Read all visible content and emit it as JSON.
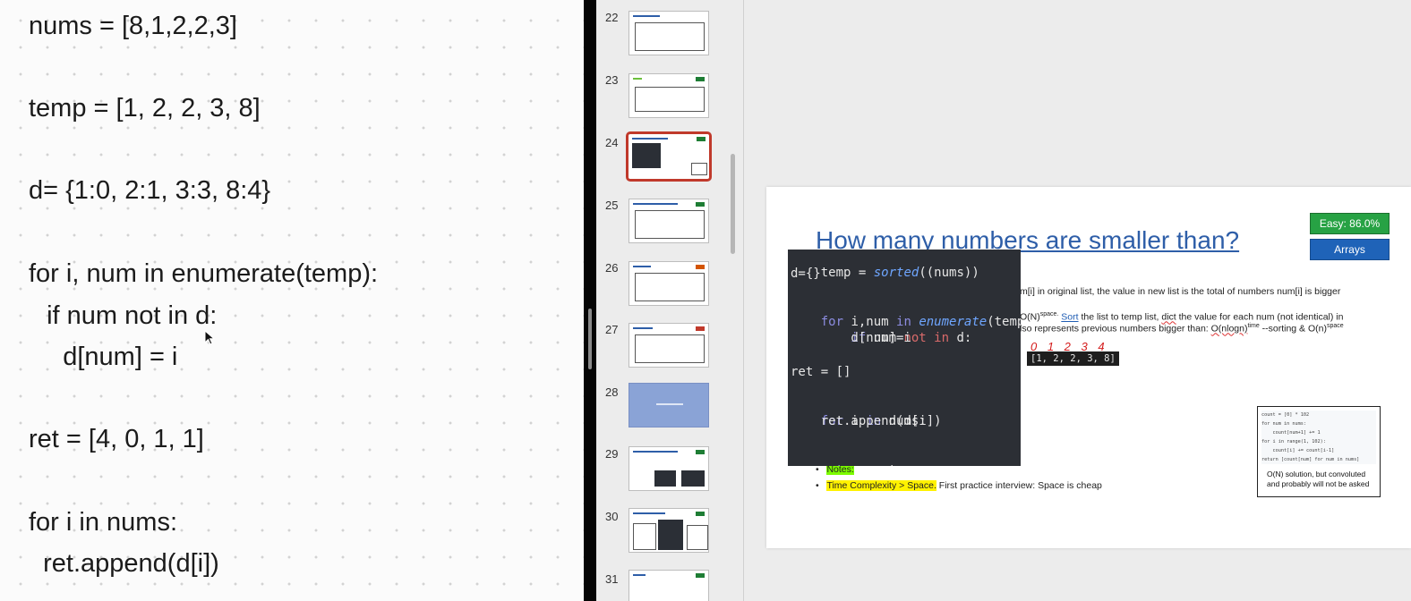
{
  "note": {
    "lines": [
      "nums = [8,1,2,2,3]",
      "temp = [1, 2, 2, 3, 8]",
      "d= {1:0, 2:1, 3:3, 8:4}",
      "for i, num in enumerate(temp):",
      "  if num not in d:",
      "    d[num] = i",
      "ret = [4, 0, 1, 1]",
      "for i in nums:",
      "  ret.append(d[i])"
    ]
  },
  "thumbnails": {
    "numbers": [
      "22",
      "23",
      "24",
      "25",
      "26",
      "27",
      "28",
      "29",
      "30",
      "31"
    ],
    "selected": "24"
  },
  "slide": {
    "title": "How many numbers are smaller than?",
    "badge_easy": "Easy: 86.0%",
    "badge_arrays": "Arrays",
    "line1": "m[i] in original list, the value in new list is the total of numbers num[i] is bigger",
    "line2_a": "O(N)",
    "line2_sup": "space.",
    "line2_b": " ",
    "line2_sort": "Sort",
    "line2_c": " the list to temp list, ",
    "line2_dict": "dict",
    "line2_d": " the value for each num (not identical) in",
    "line3_a": "lso represents  previous numbers bigger than: ",
    "line3_nlogn": "O(nlogn)",
    "line3_sup1": "time",
    "line3_b": " --sorting & O(n)",
    "line3_sup2": "space",
    "index_digits": "0 1 2 3 4",
    "sorted_list": "[1, 2, 2, 3, 8]",
    "bullet_notes": "Notes:",
    "bullet_time_hl": "Time Complexity > Space.",
    "bullet_time_rest": " First practice interview: Space is cheap",
    "alt_code": "count = [0] * 102\nfor num in nums:\n    count[num+1] += 1\nfor i in range(1, 102):\n    count[i] += count[i-1]\nreturn [count[num] for num in nums]",
    "alt_note": "O(N) solution, but convoluted and probably will not be asked"
  },
  "code_overlay": {
    "l1_a": "temp",
    "l1_b": " = ",
    "l1_fn": "sorted",
    "l1_c": "((nums))",
    "l2": "d={}",
    "l3_kw": "for",
    "l3_a": " i,num ",
    "l3_in": "in",
    "l3_fn": "enumerate",
    "l3_b": "(temp):",
    "l4_kw": "    if",
    "l4_a": " num ",
    "l4_not": "not in",
    "l4_b": " d:",
    "l5": "        d[num]=i",
    "l6": "ret = []",
    "l7_kw": "for",
    "l7_a": " i ",
    "l7_in": "in",
    "l7_b": " nums:",
    "l8": "    ret.append(d[i])",
    "l9_kw": "return",
    "l9_a": " ret"
  }
}
